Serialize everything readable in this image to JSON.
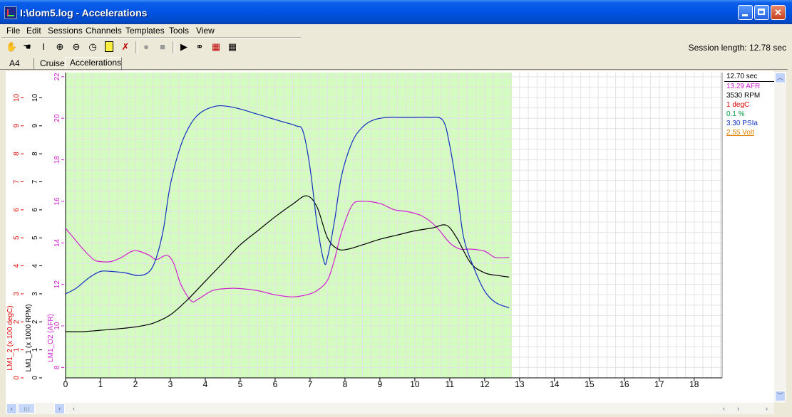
{
  "window": {
    "title": "I:\\dom5.log - Accelerations"
  },
  "menu": {
    "items": [
      "File",
      "Edit",
      "Sessions",
      "Channels",
      "Templates",
      "Tools",
      "View"
    ]
  },
  "toolbar": {
    "session_length_label": "Session length:  12.78 sec"
  },
  "tabs": [
    {
      "label": "A4",
      "active": false
    },
    {
      "label": "Cruise",
      "active": false
    },
    {
      "label": "Accelerations",
      "active": true
    }
  ],
  "readouts": [
    {
      "text": "12.70 sec",
      "color": "#000000"
    },
    {
      "text": "13.29 AFR",
      "color": "#d020d0"
    },
    {
      "text": "3530 RPM",
      "color": "#000000"
    },
    {
      "text": "1 degC",
      "color": "#e00000"
    },
    {
      "text": "0.1 %",
      "color": "#00a040"
    },
    {
      "text": "3.30 PSIa",
      "color": "#1030c0"
    },
    {
      "text": "2.55 Volt",
      "color": "#e08000"
    }
  ],
  "chart_data": {
    "type": "line",
    "xlim": [
      0,
      18.8
    ],
    "x_ticks": [
      0,
      1,
      2,
      3,
      4,
      5,
      6,
      7,
      8,
      9,
      10,
      11,
      12,
      13,
      14,
      15,
      16,
      17,
      18
    ],
    "recorded_until": 12.78,
    "colors": {
      "recorded_bg": "#d4fcc0",
      "grid": "#e3e3e3",
      "afr": "#d020d0",
      "rpm": "#000000",
      "degc": "#e00000",
      "psia": "#1030c0"
    },
    "axes": [
      {
        "label": "LM1_O2 (AFR)",
        "color": "#d020d0",
        "ylim": [
          7.5,
          22.2
        ],
        "ticks": [
          8,
          10,
          12,
          14,
          16,
          18,
          20,
          22
        ]
      },
      {
        "label": "LM1_1 (x 1000 RPM)",
        "color": "#000000",
        "ylim": [
          0,
          10.9
        ],
        "ticks": [
          0,
          1,
          2,
          3,
          4,
          5,
          6,
          7,
          8,
          9,
          10
        ]
      },
      {
        "label": "LM1_2 (x 100 degC)",
        "color": "#e00000",
        "ylim": [
          0,
          10.9
        ],
        "ticks": [
          0,
          1,
          2,
          3,
          4,
          5,
          6,
          7,
          8,
          9,
          10
        ]
      }
    ],
    "series": [
      {
        "name": "LM1_O2 (AFR)",
        "axis": 0,
        "color": "#d020d0",
        "x": [
          0,
          0.2,
          0.5,
          0.8,
          1.0,
          1.3,
          1.6,
          1.9,
          2.1,
          2.4,
          2.6,
          2.9,
          3.1,
          3.3,
          3.6,
          3.8,
          4.2,
          4.6,
          5.0,
          5.5,
          6.0,
          6.5,
          6.9,
          7.2,
          7.5,
          7.7,
          7.9,
          8.2,
          8.5,
          9.0,
          9.4,
          9.8,
          10.2,
          10.6,
          11.0,
          11.3,
          11.6,
          12.0,
          12.3,
          12.7
        ],
        "values": [
          14.7,
          14.3,
          13.7,
          13.2,
          13.1,
          13.1,
          13.3,
          13.6,
          13.6,
          13.4,
          13.2,
          13.4,
          13.0,
          12.0,
          11.2,
          11.3,
          11.7,
          11.8,
          11.8,
          11.7,
          11.5,
          11.4,
          11.5,
          11.7,
          12.2,
          13.2,
          14.5,
          15.8,
          16.0,
          15.9,
          15.6,
          15.5,
          15.3,
          14.8,
          14.0,
          13.7,
          13.7,
          13.6,
          13.3,
          13.3
        ]
      },
      {
        "name": "LM1_1 (x 1000 RPM)",
        "axis": 1,
        "color": "#000000",
        "x": [
          0,
          0.5,
          1.0,
          1.5,
          2.0,
          2.5,
          3.0,
          3.5,
          4.0,
          4.5,
          5.0,
          5.5,
          6.0,
          6.5,
          6.9,
          7.2,
          7.5,
          7.8,
          8.1,
          8.5,
          9.0,
          9.5,
          10.0,
          10.5,
          10.9,
          11.2,
          11.6,
          12.0,
          12.4,
          12.7
        ],
        "values": [
          1.65,
          1.65,
          1.7,
          1.75,
          1.82,
          1.95,
          2.25,
          2.8,
          3.45,
          4.1,
          4.75,
          5.25,
          5.75,
          6.2,
          6.5,
          6.1,
          5.0,
          4.6,
          4.6,
          4.75,
          4.95,
          5.1,
          5.25,
          5.35,
          5.45,
          5.0,
          4.1,
          3.75,
          3.65,
          3.6
        ]
      },
      {
        "name": "PSIa",
        "axis": 1,
        "color": "#1030c0",
        "x": [
          0,
          0.3,
          0.7,
          1.0,
          1.3,
          1.7,
          2.1,
          2.4,
          2.6,
          2.8,
          3.0,
          3.3,
          3.6,
          3.9,
          4.3,
          4.6,
          5.0,
          5.4,
          5.8,
          6.2,
          6.6,
          6.8,
          7.0,
          7.2,
          7.4,
          7.5,
          7.7,
          7.9,
          8.2,
          8.5,
          8.8,
          9.2,
          9.6,
          10.0,
          10.4,
          10.8,
          11.0,
          11.2,
          11.4,
          11.7,
          12.0,
          12.3,
          12.7
        ],
        "values": [
          3.0,
          3.2,
          3.6,
          3.8,
          3.8,
          3.75,
          3.65,
          3.8,
          4.3,
          5.3,
          6.9,
          8.3,
          9.1,
          9.5,
          9.7,
          9.7,
          9.6,
          9.45,
          9.3,
          9.15,
          9.0,
          8.8,
          7.5,
          5.5,
          4.15,
          4.3,
          5.6,
          7.2,
          8.4,
          8.95,
          9.2,
          9.3,
          9.3,
          9.3,
          9.3,
          9.2,
          8.3,
          6.8,
          5.0,
          3.9,
          3.1,
          2.7,
          2.5
        ]
      }
    ]
  }
}
